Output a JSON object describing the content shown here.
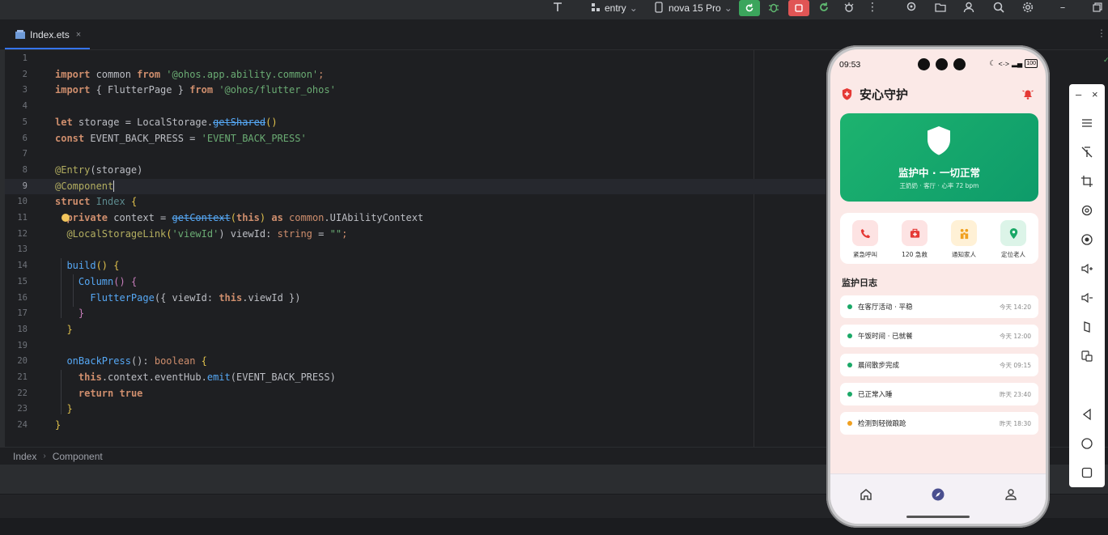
{
  "toolbar": {
    "module": "entry",
    "device": "nova 15 Pro",
    "colors": {
      "run": "#3ba55c",
      "stop": "#e05555"
    }
  },
  "tab": {
    "file_name": "Index.ets",
    "close": "×",
    "more": "⋮"
  },
  "editor": {
    "current_line": 9,
    "lines": [
      {
        "n": "1"
      },
      {
        "n": "2"
      },
      {
        "n": "3"
      },
      {
        "n": "4"
      },
      {
        "n": "5"
      },
      {
        "n": "6"
      },
      {
        "n": "7"
      },
      {
        "n": "8"
      },
      {
        "n": "9"
      },
      {
        "n": "10"
      },
      {
        "n": "11"
      },
      {
        "n": "12"
      },
      {
        "n": "13"
      },
      {
        "n": "14"
      },
      {
        "n": "15"
      },
      {
        "n": "16"
      },
      {
        "n": "17"
      },
      {
        "n": "18"
      },
      {
        "n": "19"
      },
      {
        "n": "20"
      },
      {
        "n": "21"
      },
      {
        "n": "22"
      },
      {
        "n": "23"
      },
      {
        "n": "24"
      }
    ],
    "code": {
      "l2": [
        "import",
        " common ",
        "from",
        " ",
        "'@ohos.app.ability.common'",
        ";"
      ],
      "l3": [
        "import",
        " { FlutterPage } ",
        "from",
        " ",
        "'@ohos/flutter_ohos'"
      ],
      "l5": [
        "let",
        " storage = LocalStorage.",
        "getShared",
        "()"
      ],
      "l6": [
        "const",
        " EVENT_BACK_PRESS = ",
        "'EVENT_BACK_PRESS'"
      ],
      "l8": [
        "@Entry",
        "(storage)"
      ],
      "l9": [
        "@Component"
      ],
      "l10": [
        "struct",
        " ",
        "Index",
        " {"
      ],
      "l11": [
        "private",
        " context = ",
        "getContext",
        "(",
        "this",
        ") ",
        "as",
        " ",
        "common",
        ".UIAbilityContext"
      ],
      "l12": [
        "@LocalStorageLink",
        "(",
        "'viewId'",
        ") viewId: ",
        "string",
        " = ",
        "\"\"",
        ";"
      ],
      "l14": [
        "build",
        "() {"
      ],
      "l15": [
        "Column",
        "() {"
      ],
      "l16": [
        "FlutterPage",
        "({ viewId: ",
        "this",
        ".viewId })"
      ],
      "l17": [
        "}"
      ],
      "l18": [
        "}"
      ],
      "l20": [
        "onBackPress",
        "(): ",
        "boolean",
        " {"
      ],
      "l21": [
        "this",
        ".context.eventHub.",
        "emit",
        "(EVENT_BACK_PRESS)"
      ],
      "l22": [
        "return",
        " ",
        "true"
      ],
      "l23": [
        "}"
      ],
      "l24": [
        "}"
      ]
    }
  },
  "breadcrumb": [
    "Index",
    "Component"
  ],
  "phone": {
    "status": {
      "time": "09:53",
      "battery": "100"
    },
    "app_title": "安心守护",
    "hero": {
      "title": "监护中 · 一切正常",
      "subtitle": "王奶奶 · 客厅 · 心率 72 bpm"
    },
    "quick_actions": [
      {
        "label": "紧急呼叫",
        "icon": "phone-icon",
        "bg": "#fde3e3",
        "fg": "#e53935"
      },
      {
        "label": "120 急救",
        "icon": "medkit-icon",
        "bg": "#fde3e3",
        "fg": "#e53935"
      },
      {
        "label": "通知家人",
        "icon": "family-icon",
        "bg": "#fff1d6",
        "fg": "#f0a020"
      },
      {
        "label": "定位老人",
        "icon": "location-icon",
        "bg": "#dcf4e8",
        "fg": "#1aa867"
      }
    ],
    "log_heading": "监护日志",
    "logs": [
      {
        "text": "在客厅活动 · 平稳",
        "time": "今天 14:20",
        "dot": "#1aa867"
      },
      {
        "text": "午饭时间 · 已就餐",
        "time": "今天 12:00",
        "dot": "#1aa867"
      },
      {
        "text": "晨间散步完成",
        "time": "今天 09:15",
        "dot": "#1aa867"
      },
      {
        "text": "已正常入睡",
        "time": "昨天 23:40",
        "dot": "#1aa867"
      },
      {
        "text": "检测到轻微踉跄",
        "time": "昨天 18:30",
        "dot": "#f0a020"
      }
    ],
    "nav": [
      "home-icon",
      "compass-icon",
      "person-icon"
    ]
  },
  "emulator_toolbar": {
    "minimize": "–",
    "close": "×",
    "buttons": [
      "menu-icon",
      "pin-icon",
      "crop-icon",
      "rotate-icon",
      "screenshot-icon",
      "volume-up-icon",
      "volume-down-icon",
      "fold-icon",
      "multi-screen-icon",
      "back-icon",
      "home-circle-icon",
      "recents-icon"
    ]
  }
}
